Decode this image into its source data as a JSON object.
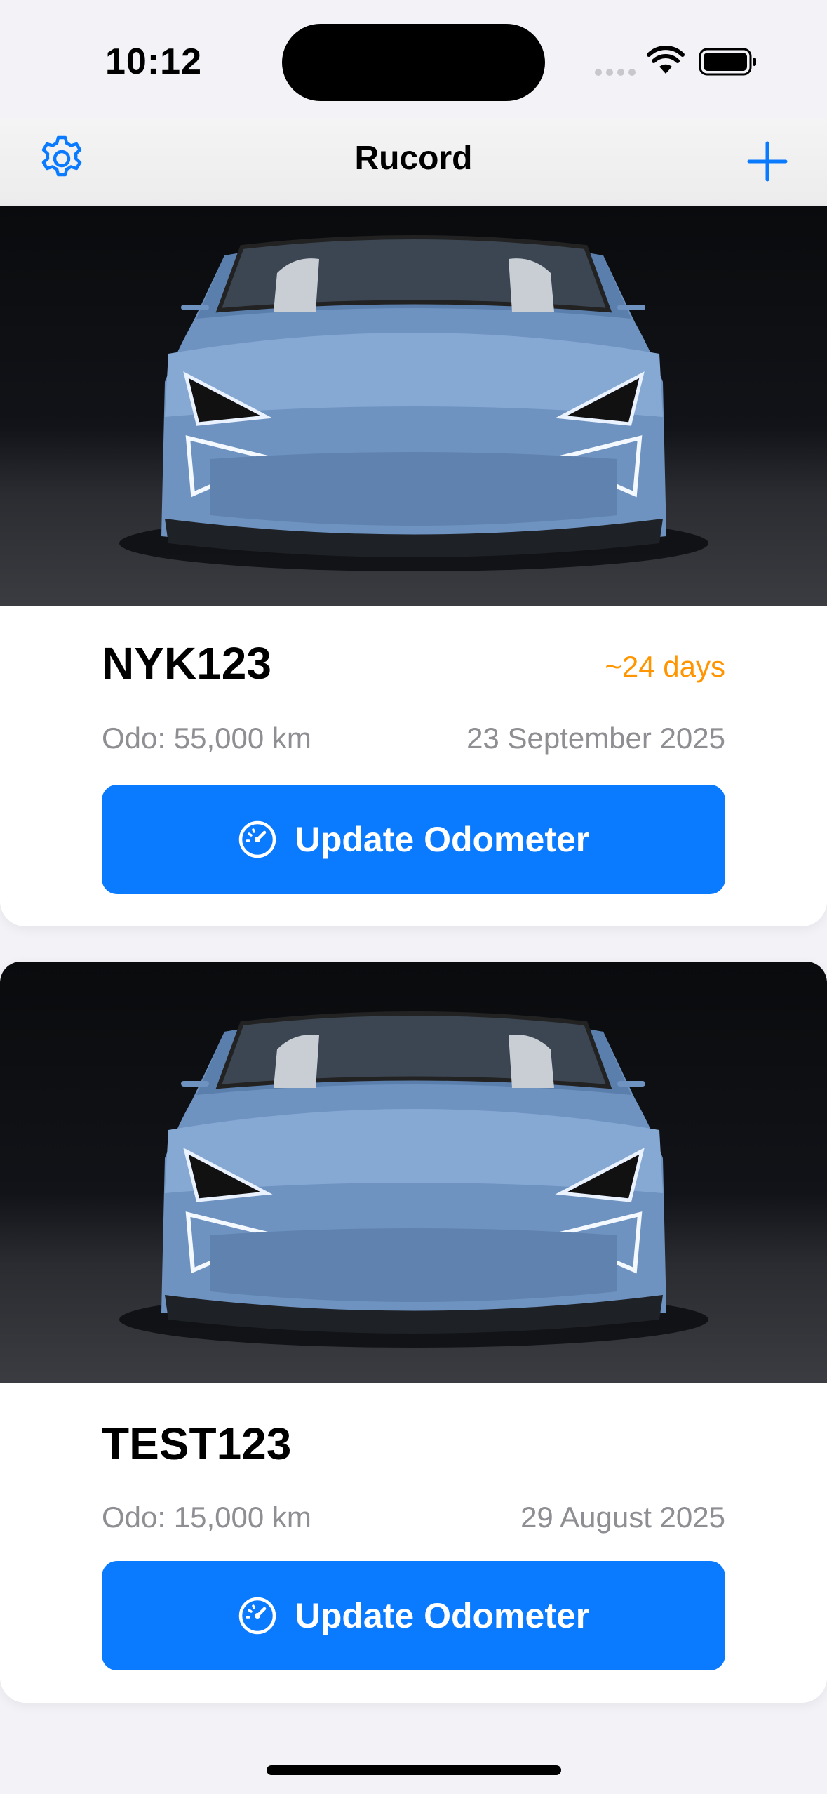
{
  "status_bar": {
    "time": "10:12"
  },
  "nav": {
    "title": "Rucord"
  },
  "vehicles": [
    {
      "plate": "NYK123",
      "due": "~24 days",
      "odometer": "Odo: 55,000 km",
      "date": "23 September 2025",
      "button_label": "Update Odometer"
    },
    {
      "plate": "TEST123",
      "due": "",
      "odometer": "Odo: 15,000 km",
      "date": "29 August 2025",
      "button_label": "Update Odometer"
    }
  ],
  "colors": {
    "accent": "#0a7aff",
    "due_warning": "#ff9500",
    "secondary_text": "#8e8e93"
  },
  "icons": {
    "settings": "gear-icon",
    "add": "plus-icon",
    "update": "speedometer-icon"
  }
}
